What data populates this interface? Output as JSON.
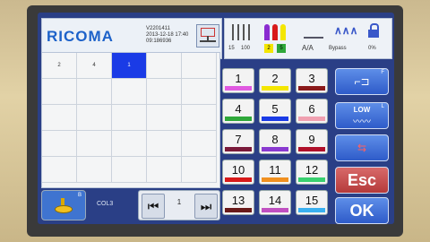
{
  "header": {
    "logo": "RICOMA",
    "version_lines": [
      "V2201411",
      "2013-12-18 17:40",
      "09:186936"
    ]
  },
  "grid": {
    "cells": [
      {
        "label": "2",
        "selected": false
      },
      {
        "label": "4",
        "selected": false
      },
      {
        "label": "1",
        "selected": true
      },
      {
        "label": "",
        "selected": false
      },
      {
        "label": "",
        "selected": false
      }
    ]
  },
  "toolbar": {
    "needle_count": "15",
    "needle_sub": "100",
    "cone_yellow": "2",
    "cone_green": "5",
    "aa_label": "A/A",
    "zig_label": "Bypass",
    "lock_label": "0%"
  },
  "needle_buttons": [
    {
      "num": "1",
      "color": "#e05ae0"
    },
    {
      "num": "2",
      "color": "#f4e600"
    },
    {
      "num": "3",
      "color": "#8a1a1a"
    },
    {
      "num": "4",
      "color": "#2fa83a"
    },
    {
      "num": "5",
      "color": "#1a3be6"
    },
    {
      "num": "6",
      "color": "#f0a0b0"
    },
    {
      "num": "7",
      "color": "#7a1a3a"
    },
    {
      "num": "8",
      "color": "#8a3ad0"
    },
    {
      "num": "9",
      "color": "#b0102a"
    },
    {
      "num": "10",
      "color": "#d81a1a"
    },
    {
      "num": "11",
      "color": "#f09020"
    },
    {
      "num": "12",
      "color": "#3ad070"
    },
    {
      "num": "13",
      "color": "#6a1a1a"
    },
    {
      "num": "14",
      "color": "#c050c0"
    },
    {
      "num": "15",
      "color": "#3ab0f0"
    }
  ],
  "right_buttons": {
    "frame_tag": "F",
    "low_label": "LOW",
    "low_tag": "L",
    "esc_label": "Esc",
    "ok_label": "OK"
  },
  "bottom": {
    "spool_tag": "B",
    "col_label": "COL3",
    "page_num": "1",
    "prev_glyph": "⏮",
    "next_glyph": "⏭"
  }
}
